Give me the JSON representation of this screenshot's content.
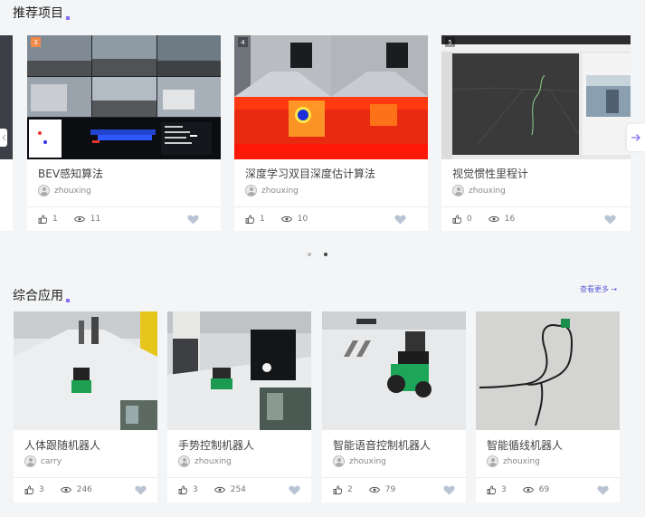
{
  "recommended": {
    "title": "推荐项目",
    "cards": [
      {
        "badge": "3",
        "title": "BEV感知算法",
        "author": "zhouxing",
        "likes": "1",
        "views": "11"
      },
      {
        "badge": "4",
        "title": "深度学习双目深度估计算法",
        "author": "zhouxing",
        "likes": "1",
        "views": "10"
      },
      {
        "badge": "5",
        "title": "视觉惯性里程计",
        "author": "zhouxing",
        "likes": "0",
        "views": "16"
      }
    ]
  },
  "apps": {
    "title": "综合应用",
    "more": "查看更多 →",
    "cards": [
      {
        "title": "人体跟随机器人",
        "author": "carry",
        "likes": "3",
        "views": "246"
      },
      {
        "title": "手势控制机器人",
        "author": "zhouxing",
        "likes": "3",
        "views": "254"
      },
      {
        "title": "智能语音控制机器人",
        "author": "zhouxing",
        "likes": "2",
        "views": "79"
      },
      {
        "title": "智能循线机器人",
        "author": "zhouxing",
        "likes": "3",
        "views": "69"
      }
    ]
  },
  "colors": {
    "accent": "#8a6df2",
    "heart": "#b8c4d4",
    "active_dot": "#444444",
    "inactive_dot": "#bbbbbb"
  },
  "icons": [
    "thumb-up-icon",
    "eye-icon",
    "heart-icon",
    "user-avatar-icon",
    "arrow-right-icon",
    "arrow-left-icon"
  ]
}
